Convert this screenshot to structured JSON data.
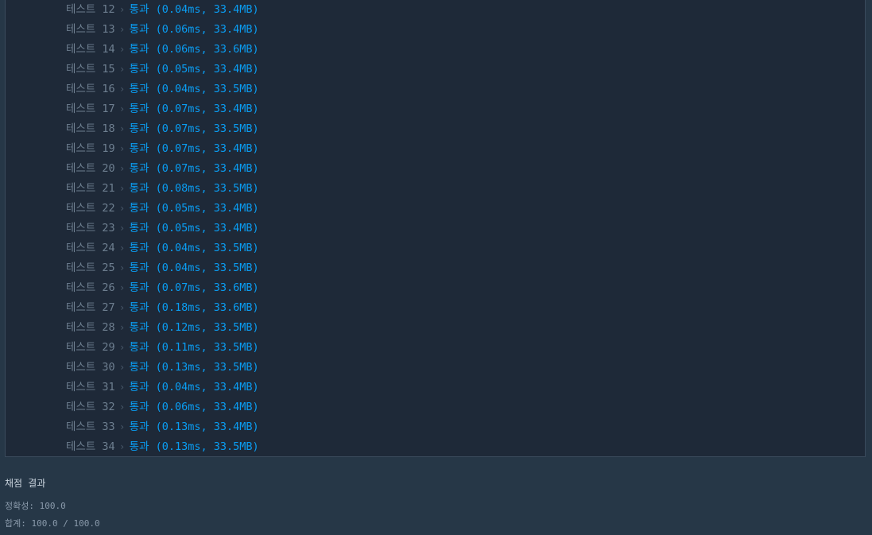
{
  "tests": [
    {
      "label": "테스트 12",
      "status": "통과",
      "result": "(0.04ms, 33.4MB)"
    },
    {
      "label": "테스트 13",
      "status": "통과",
      "result": "(0.06ms, 33.4MB)"
    },
    {
      "label": "테스트 14",
      "status": "통과",
      "result": "(0.06ms, 33.6MB)"
    },
    {
      "label": "테스트 15",
      "status": "통과",
      "result": "(0.05ms, 33.4MB)"
    },
    {
      "label": "테스트 16",
      "status": "통과",
      "result": "(0.04ms, 33.5MB)"
    },
    {
      "label": "테스트 17",
      "status": "통과",
      "result": "(0.07ms, 33.4MB)"
    },
    {
      "label": "테스트 18",
      "status": "통과",
      "result": "(0.07ms, 33.5MB)"
    },
    {
      "label": "테스트 19",
      "status": "통과",
      "result": "(0.07ms, 33.4MB)"
    },
    {
      "label": "테스트 20",
      "status": "통과",
      "result": "(0.07ms, 33.4MB)"
    },
    {
      "label": "테스트 21",
      "status": "통과",
      "result": "(0.08ms, 33.5MB)"
    },
    {
      "label": "테스트 22",
      "status": "통과",
      "result": "(0.05ms, 33.4MB)"
    },
    {
      "label": "테스트 23",
      "status": "통과",
      "result": "(0.05ms, 33.4MB)"
    },
    {
      "label": "테스트 24",
      "status": "통과",
      "result": "(0.04ms, 33.5MB)"
    },
    {
      "label": "테스트 25",
      "status": "통과",
      "result": "(0.04ms, 33.5MB)"
    },
    {
      "label": "테스트 26",
      "status": "통과",
      "result": "(0.07ms, 33.6MB)"
    },
    {
      "label": "테스트 27",
      "status": "통과",
      "result": "(0.18ms, 33.6MB)"
    },
    {
      "label": "테스트 28",
      "status": "통과",
      "result": "(0.12ms, 33.5MB)"
    },
    {
      "label": "테스트 29",
      "status": "통과",
      "result": "(0.11ms, 33.5MB)"
    },
    {
      "label": "테스트 30",
      "status": "통과",
      "result": "(0.13ms, 33.5MB)"
    },
    {
      "label": "테스트 31",
      "status": "통과",
      "result": "(0.04ms, 33.4MB)"
    },
    {
      "label": "테스트 32",
      "status": "통과",
      "result": "(0.06ms, 33.4MB)"
    },
    {
      "label": "테스트 33",
      "status": "통과",
      "result": "(0.13ms, 33.4MB)"
    },
    {
      "label": "테스트 34",
      "status": "통과",
      "result": "(0.13ms, 33.5MB)"
    }
  ],
  "arrow_icon": "chevron-right-icon",
  "summary": {
    "title": "채점 결과",
    "accuracy": "정확성: 100.0",
    "total": "합계: 100.0 / 100.0"
  },
  "colors": {
    "page_bg": "#263747",
    "panel_bg": "#1e2938",
    "pass": "#0a9df2",
    "label": "#6e7f90"
  }
}
